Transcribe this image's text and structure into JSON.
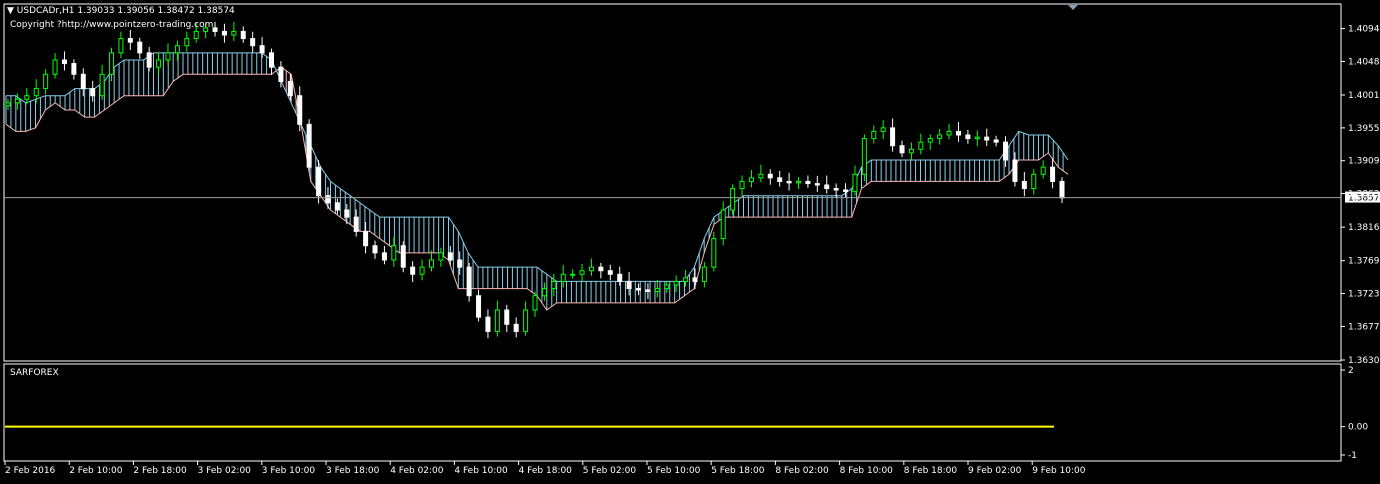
{
  "header": {
    "symbol_line": "USDCADr,H1  1.39033 1.39056 1.38472 1.38574",
    "copyright": "Copyright ?http://www.pointzero-trading.com"
  },
  "subwindow": {
    "title": "SARFOREX"
  },
  "colors": {
    "background": "#000000",
    "frame": "#ffffff",
    "bull_candle": "#00ff00",
    "bear_candle": "#ffffff",
    "cloud_up": "#87ceeb",
    "cloud_down": "#ffb6b6",
    "indicator_line": "#ffff00",
    "price_line": "#c0c0c0"
  },
  "chart_data": [
    {
      "type": "candlestick",
      "title": "USDCADr,H1",
      "current_price": "1.38574",
      "ylim": [
        1.363,
        1.412
      ],
      "y_ticks": [
        "1.40940",
        "1.40480",
        "1.40010",
        "1.39550",
        "1.39090",
        "1.38630",
        "1.38160",
        "1.37690",
        "1.37230",
        "1.36770",
        "1.36300"
      ],
      "x_ticks": [
        "2 Feb 2016",
        "2 Feb 10:00",
        "2 Feb 18:00",
        "3 Feb 02:00",
        "3 Feb 10:00",
        "3 Feb 18:00",
        "4 Feb 02:00",
        "4 Feb 10:00",
        "4 Feb 18:00",
        "5 Feb 02:00",
        "5 Feb 10:00",
        "5 Feb 18:00",
        "8 Feb 02:00",
        "8 Feb 10:00",
        "8 Feb 18:00",
        "9 Feb 02:00",
        "9 Feb 10:00"
      ],
      "close_path": [
        1.399,
        1.3995,
        1.4,
        1.401,
        1.403,
        1.405,
        1.4045,
        1.403,
        1.401,
        1.4,
        1.403,
        1.406,
        1.408,
        1.4075,
        1.406,
        1.404,
        1.405,
        1.406,
        1.407,
        1.408,
        1.409,
        1.4095,
        1.409,
        1.4085,
        1.409,
        1.408,
        1.407,
        1.406,
        1.404,
        1.402,
        1.4,
        1.396,
        1.39,
        1.386,
        1.385,
        1.384,
        1.383,
        1.381,
        1.379,
        1.378,
        1.377,
        1.379,
        1.376,
        1.375,
        1.376,
        1.377,
        1.378,
        1.377,
        1.376,
        1.372,
        1.369,
        1.367,
        1.37,
        1.368,
        1.367,
        1.37,
        1.372,
        1.373,
        1.374,
        1.375,
        1.375,
        1.3755,
        1.376,
        1.3755,
        1.375,
        1.374,
        1.373,
        1.3728,
        1.3726,
        1.373,
        1.3735,
        1.374,
        1.3745,
        1.374,
        1.376,
        1.38,
        1.384,
        1.387,
        1.388,
        1.3885,
        1.389,
        1.3885,
        1.388,
        1.3878,
        1.388,
        1.3877,
        1.3875,
        1.387,
        1.3868,
        1.3866,
        1.389,
        1.394,
        1.395,
        1.3955,
        1.393,
        1.392,
        1.3925,
        1.3935,
        1.394,
        1.3945,
        1.395,
        1.3945,
        1.394,
        1.3942,
        1.3938,
        1.3935,
        1.391,
        1.388,
        1.387,
        1.389,
        1.39,
        1.388,
        1.3857
      ],
      "cloud_span_a": [
        1.4,
        1.4,
        1.399,
        1.3995,
        1.4,
        1.4,
        1.4,
        1.401,
        1.401,
        1.401,
        1.402,
        1.404,
        1.405,
        1.405,
        1.405,
        1.406,
        1.406,
        1.406,
        1.406,
        1.406,
        1.406,
        1.406,
        1.406,
        1.406,
        1.406,
        1.406,
        1.406,
        1.405,
        1.402,
        1.399,
        1.396,
        1.393,
        1.39,
        1.388,
        1.387,
        1.386,
        1.385,
        1.384,
        1.383,
        1.383,
        1.383,
        1.383,
        1.383,
        1.383,
        1.383,
        1.383,
        1.381,
        1.378,
        1.376,
        1.376,
        1.376,
        1.376,
        1.376,
        1.376,
        1.376,
        1.375,
        1.374,
        1.374,
        1.374,
        1.374,
        1.374,
        1.374,
        1.374,
        1.374,
        1.374,
        1.374,
        1.374,
        1.374,
        1.374,
        1.374,
        1.376,
        1.38,
        1.383,
        1.384,
        1.385,
        1.386,
        1.386,
        1.386,
        1.386,
        1.386,
        1.386,
        1.386,
        1.386,
        1.386,
        1.386,
        1.386,
        1.387,
        1.39,
        1.391,
        1.391,
        1.391,
        1.391,
        1.391,
        1.391,
        1.391,
        1.391,
        1.391,
        1.391,
        1.391,
        1.391,
        1.391,
        1.391,
        1.393,
        1.395,
        1.3945,
        1.3945,
        1.3945,
        1.393,
        1.391
      ],
      "cloud_span_b": [
        1.396,
        1.395,
        1.395,
        1.3955,
        1.398,
        1.399,
        1.398,
        1.398,
        1.397,
        1.397,
        1.398,
        1.399,
        1.4,
        1.4,
        1.4,
        1.4,
        1.4,
        1.402,
        1.403,
        1.403,
        1.403,
        1.403,
        1.403,
        1.403,
        1.403,
        1.403,
        1.403,
        1.403,
        1.404,
        1.403,
        1.396,
        1.388,
        1.386,
        1.384,
        1.383,
        1.382,
        1.381,
        1.381,
        1.38,
        1.379,
        1.378,
        1.378,
        1.378,
        1.378,
        1.378,
        1.377,
        1.373,
        1.373,
        1.373,
        1.373,
        1.373,
        1.373,
        1.373,
        1.373,
        1.372,
        1.37,
        1.371,
        1.371,
        1.371,
        1.371,
        1.371,
        1.371,
        1.371,
        1.371,
        1.371,
        1.371,
        1.371,
        1.371,
        1.371,
        1.372,
        1.373,
        1.378,
        1.382,
        1.383,
        1.383,
        1.383,
        1.383,
        1.383,
        1.383,
        1.383,
        1.383,
        1.383,
        1.383,
        1.383,
        1.383,
        1.383,
        1.383,
        1.387,
        1.388,
        1.388,
        1.388,
        1.388,
        1.388,
        1.388,
        1.388,
        1.388,
        1.388,
        1.388,
        1.388,
        1.388,
        1.388,
        1.388,
        1.389,
        1.391,
        1.391,
        1.391,
        1.392,
        1.39,
        1.389
      ]
    },
    {
      "type": "line",
      "title": "SARFOREX",
      "ylim": [
        -1,
        2
      ],
      "y_ticks": [
        "2",
        "0.00",
        "-1"
      ],
      "values_constant": 0.0
    }
  ]
}
